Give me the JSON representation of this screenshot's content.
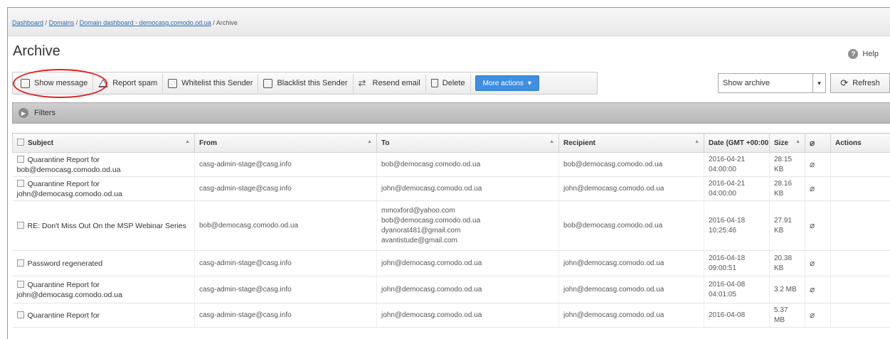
{
  "breadcrumb": {
    "items": [
      "Dashboard",
      "Domains",
      "Domain dashboard - democasg.comodo.od.ua"
    ],
    "separator": "/",
    "current": "Archive"
  },
  "page": {
    "title": "Archive",
    "help_label": "Help"
  },
  "toolbar": {
    "show_message": "Show message",
    "report_spam": "Report spam",
    "whitelist": "Whitelist this Sender",
    "blacklist": "Blacklist this Sender",
    "resend": "Resend email",
    "delete": "Delete",
    "more_actions": "More actions"
  },
  "archive_select": {
    "value": "Show archive"
  },
  "refresh_label": "Refresh",
  "filters_label": "Filters",
  "table": {
    "columns": [
      "Subject",
      "From",
      "To",
      "Recipient",
      "Date (GMT +00:00",
      "Size",
      "",
      "Actions"
    ],
    "rows": [
      {
        "subject": "Quarantine Report for bob@democasg.comodo.od.ua",
        "from": "casg-admin-stage@casg.info",
        "to": [
          "bob@democasg.comodo.od.ua"
        ],
        "recipient": "bob@democasg.comodo.od.ua",
        "date": "2016-04-21 04:00:00",
        "size": "28.15 KB"
      },
      {
        "subject": "Quarantine Report for john@democasg.comodo.od.ua",
        "from": "casg-admin-stage@casg.info",
        "to": [
          "john@democasg.comodo.od.ua"
        ],
        "recipient": "john@democasg.comodo.od.ua",
        "date": "2016-04-21 04:00:00",
        "size": "28.16 KB"
      },
      {
        "subject": "RE: Don't Miss Out On the MSP Webinar Series",
        "from": "bob@democasg.comodo.od.ua",
        "to": [
          "mmoxford@yahoo.com",
          "bob@democasg.comodo.od.ua",
          "dyanorat481@gmail.com",
          "avantistude@gmail.com"
        ],
        "recipient": "bob@democasg.comodo.od.ua",
        "date": "2016-04-18 10:25:46",
        "size": "27.91 KB"
      },
      {
        "subject": "Password regenerated",
        "from": "casg-admin-stage@casg.info",
        "to": [
          "john@democasg.comodo.od.ua"
        ],
        "recipient": "john@democasg.comodo.od.ua",
        "date": "2016-04-18 09:00:51",
        "size": "20.38 KB"
      },
      {
        "subject": "Quarantine Report for john@democasg.comodo.od.ua",
        "from": "casg-admin-stage@casg.info",
        "to": [
          "john@democasg.comodo.od.ua"
        ],
        "recipient": "john@democasg.comodo.od.ua",
        "date": "2016-04-08 04:01:05",
        "size": "3.2 MB"
      },
      {
        "subject": "Quarantine Report for",
        "from": "casg-admin-stage@casg.info",
        "to": [
          "john@democasg.comodo.od.ua"
        ],
        "recipient": "john@democasg.comodo.od.ua",
        "date": "2016-04-08",
        "size": "5.37 MB"
      }
    ]
  },
  "colors": {
    "accent": "#3f8fe0",
    "highlight": "#e02020",
    "filters_bar": "#c4c4c4"
  }
}
